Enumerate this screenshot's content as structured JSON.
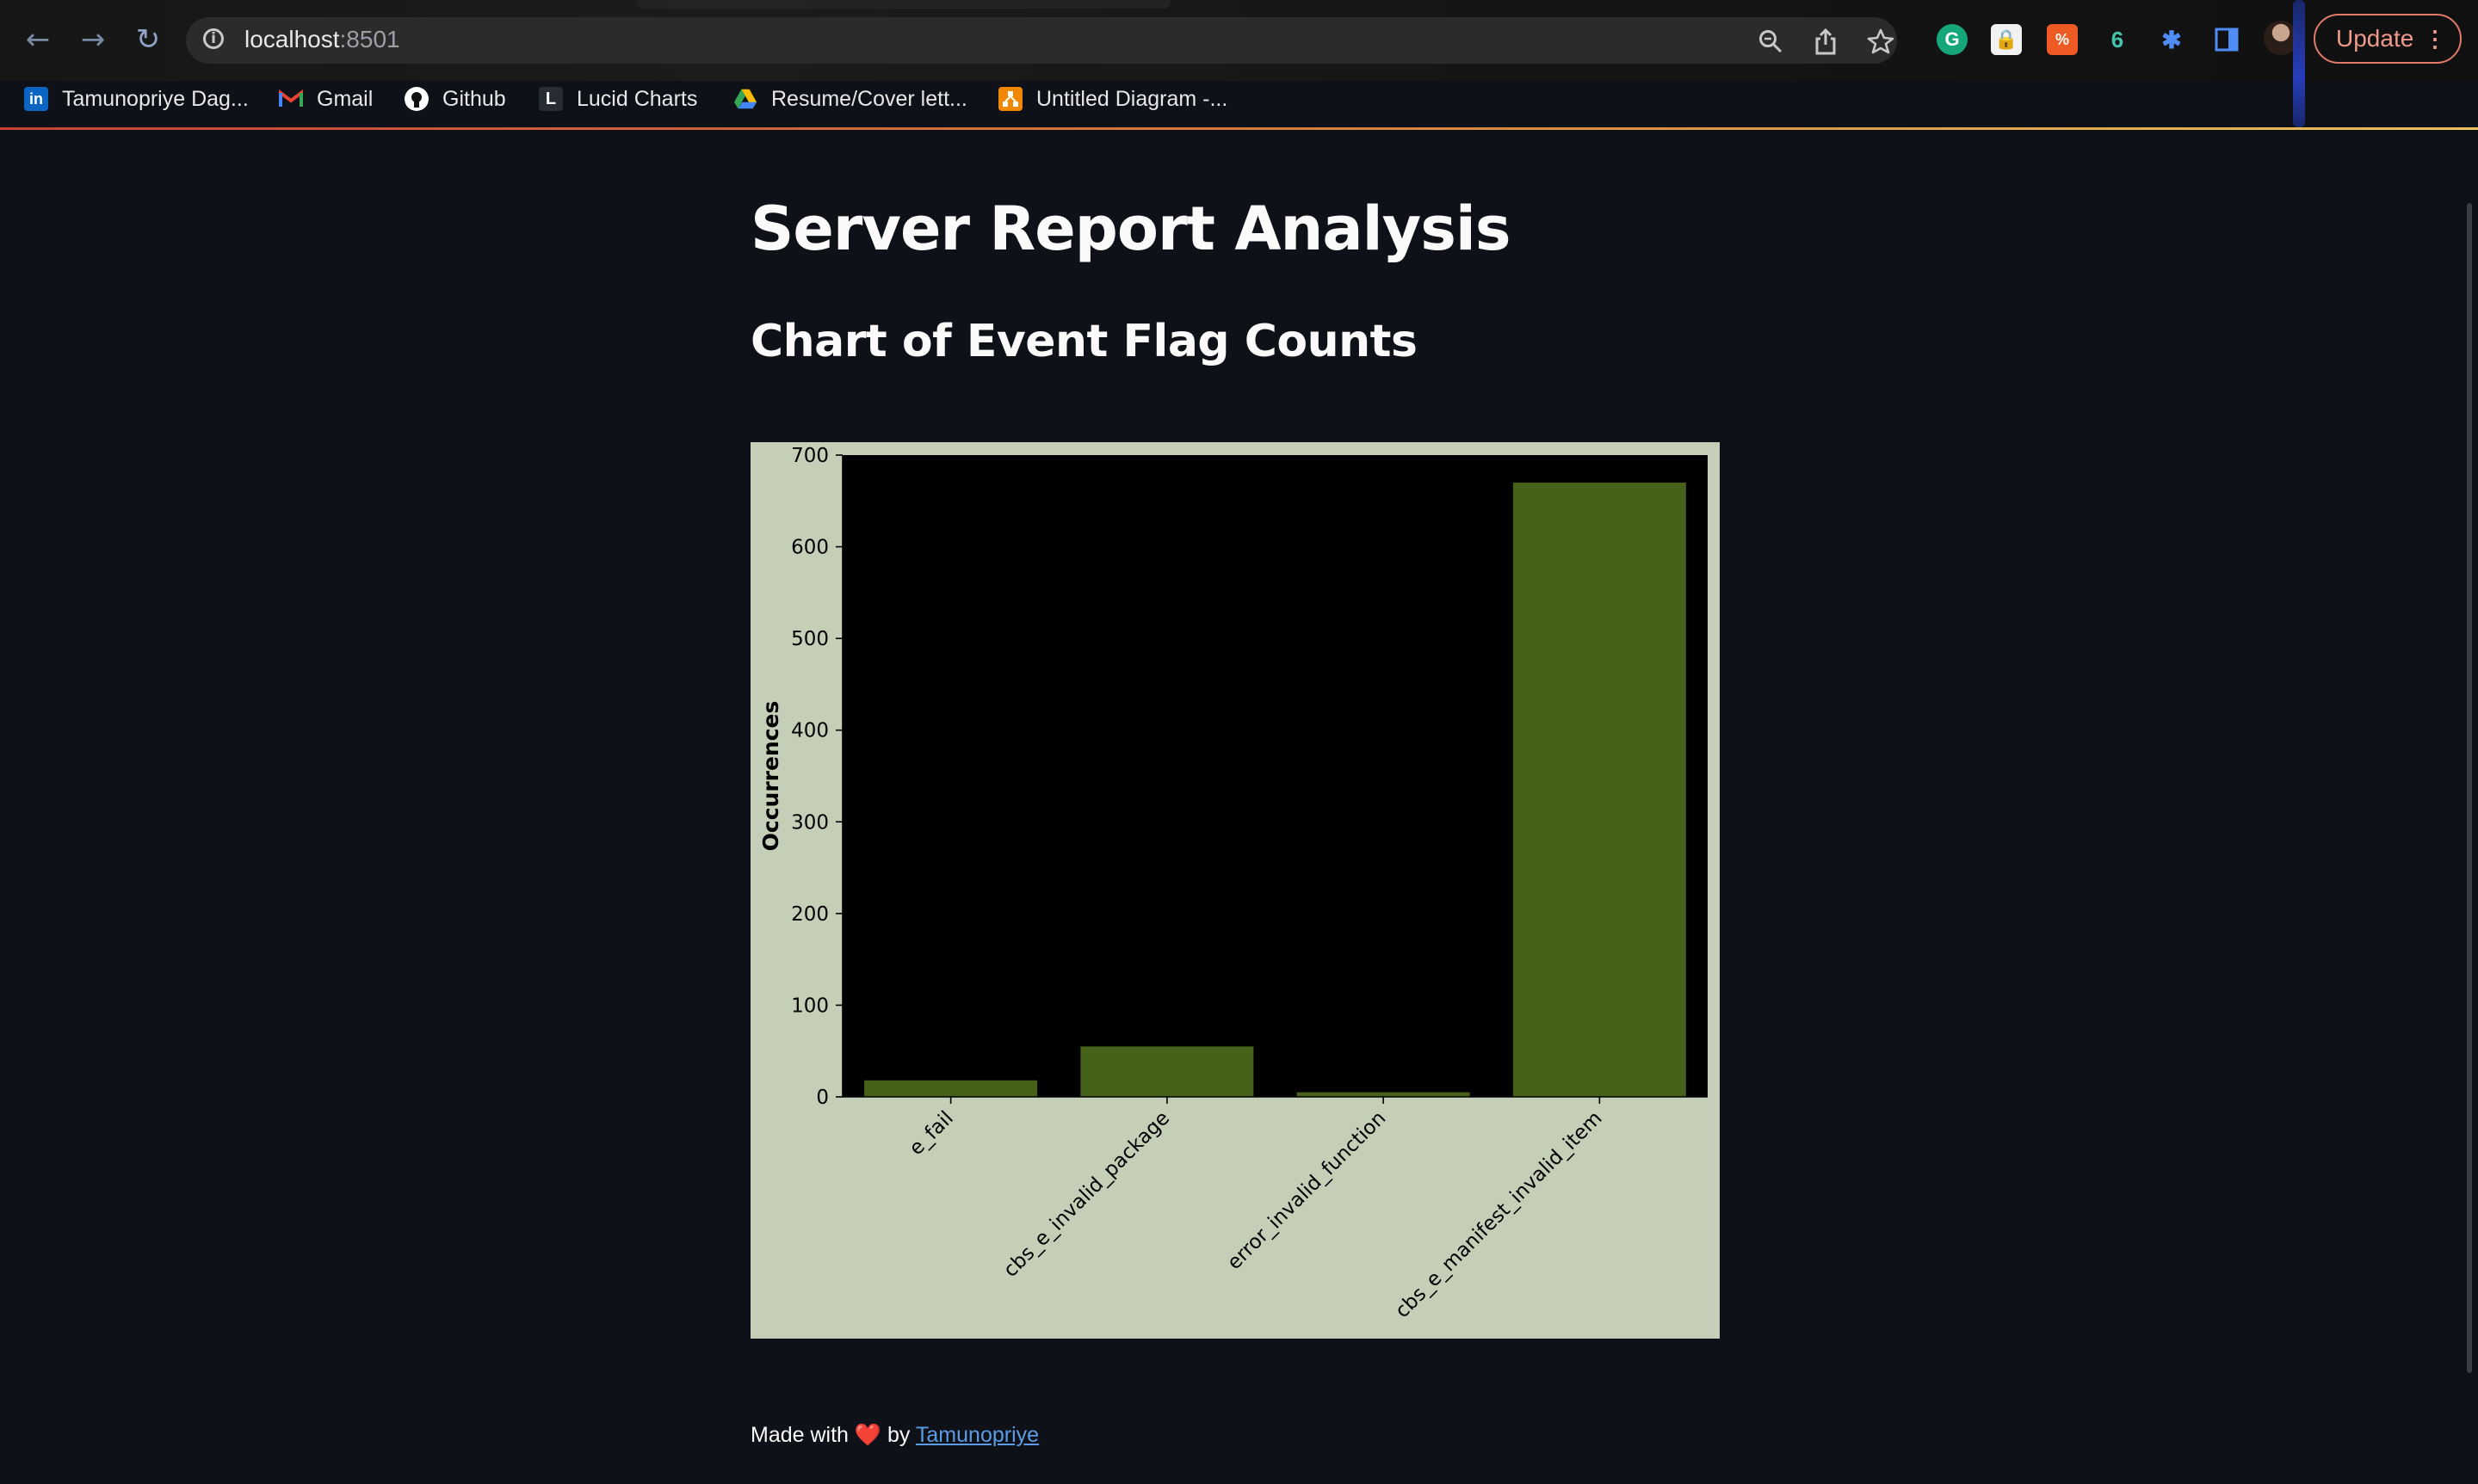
{
  "browser": {
    "url_host": "localhost",
    "url_port": ":8501",
    "update_label": "Update",
    "bookmarks": [
      {
        "label": "Tamunopriye Dag...",
        "icon": "linkedin-icon"
      },
      {
        "label": "Gmail",
        "icon": "gmail-icon"
      },
      {
        "label": "Github",
        "icon": "github-icon"
      },
      {
        "label": "Lucid Charts",
        "icon": "lucid-icon"
      },
      {
        "label": "Resume/Cover lett...",
        "icon": "google-drive-icon"
      },
      {
        "label": "Untitled Diagram -...",
        "icon": "drawio-icon"
      }
    ]
  },
  "page": {
    "title": "Server Report Analysis",
    "subtitle": "Chart of Event Flag Counts",
    "footer": {
      "prefix": "Made with",
      "heart": "❤️",
      "by": "by",
      "author": "Tamunopriye"
    }
  },
  "colors": {
    "bar": "#466119",
    "plot_bg": "#000000",
    "figure_bg": "#c5cfb7",
    "page_bg": "#0e1117",
    "link": "#5c9ce6"
  },
  "chart_data": {
    "type": "bar",
    "categories": [
      "e_fail",
      "cbs_e_invalid_package",
      "error_invalid_function",
      "cbs_e_manifest_invalid_item"
    ],
    "values": [
      18,
      55,
      5,
      670
    ],
    "ylabel": "Occurrences",
    "xlabel": "",
    "ylim": [
      0,
      700
    ],
    "yticks": [
      0,
      100,
      200,
      300,
      400,
      500,
      600,
      700
    ],
    "grid": false
  }
}
